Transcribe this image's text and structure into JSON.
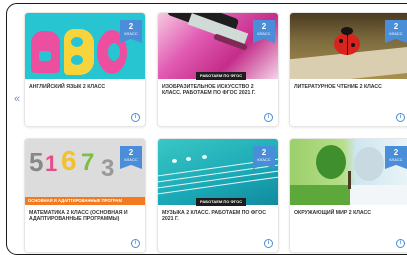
{
  "nav": {
    "prev_label": "«"
  },
  "cards": [
    {
      "grade": "2",
      "grade_word": "КЛАСС",
      "title": "АНГЛИЙСКИЙ ЯЗЫК 2 КЛАСС",
      "fgos": "",
      "info": "i"
    },
    {
      "grade": "2",
      "grade_word": "КЛАСС",
      "title": "ИЗОБРАЗИТЕЛЬНОЕ ИСКУССТВО 2 КЛАСС. РАБОТАЕМ ПО ФГОС 2021 Г.",
      "fgos": "РАБОТАЕМ ПО ФГОС",
      "info": "i"
    },
    {
      "grade": "2",
      "grade_word": "КЛАСС",
      "title": "ЛИТЕРАТУРНОЕ ЧТЕНИЕ 2 КЛАСС",
      "fgos": "",
      "info": "i"
    },
    {
      "grade": "2",
      "grade_word": "КЛАСС",
      "title": "МАТЕМАТИКА 2 КЛАСС (ОСНОВНАЯ И АДАПТИРОВАННЫЕ ПРОГРАММЫ)",
      "fgos": "",
      "image_caption": "ОСНОВНАЯ И АДАПТИРОВАННЫЕ ПРОГРАМ",
      "info": "i"
    },
    {
      "grade": "2",
      "grade_word": "КЛАСС",
      "title": "МУЗЫКА 2 КЛАСС. РАБОТАЕМ ПО ФГОС 2021 Г.",
      "fgos": "РАБОТАЕМ ПО ФГОС",
      "info": "i"
    },
    {
      "grade": "2",
      "grade_word": "КЛАСС",
      "title": "ОКРУЖАЮЩИЙ МИР 2 КЛАСС",
      "fgos": "",
      "info": "i"
    }
  ],
  "colors": {
    "badge": "#4a8dd8",
    "fgos_bar": "#1d1d1d",
    "accent_orange": "#f47a20"
  }
}
